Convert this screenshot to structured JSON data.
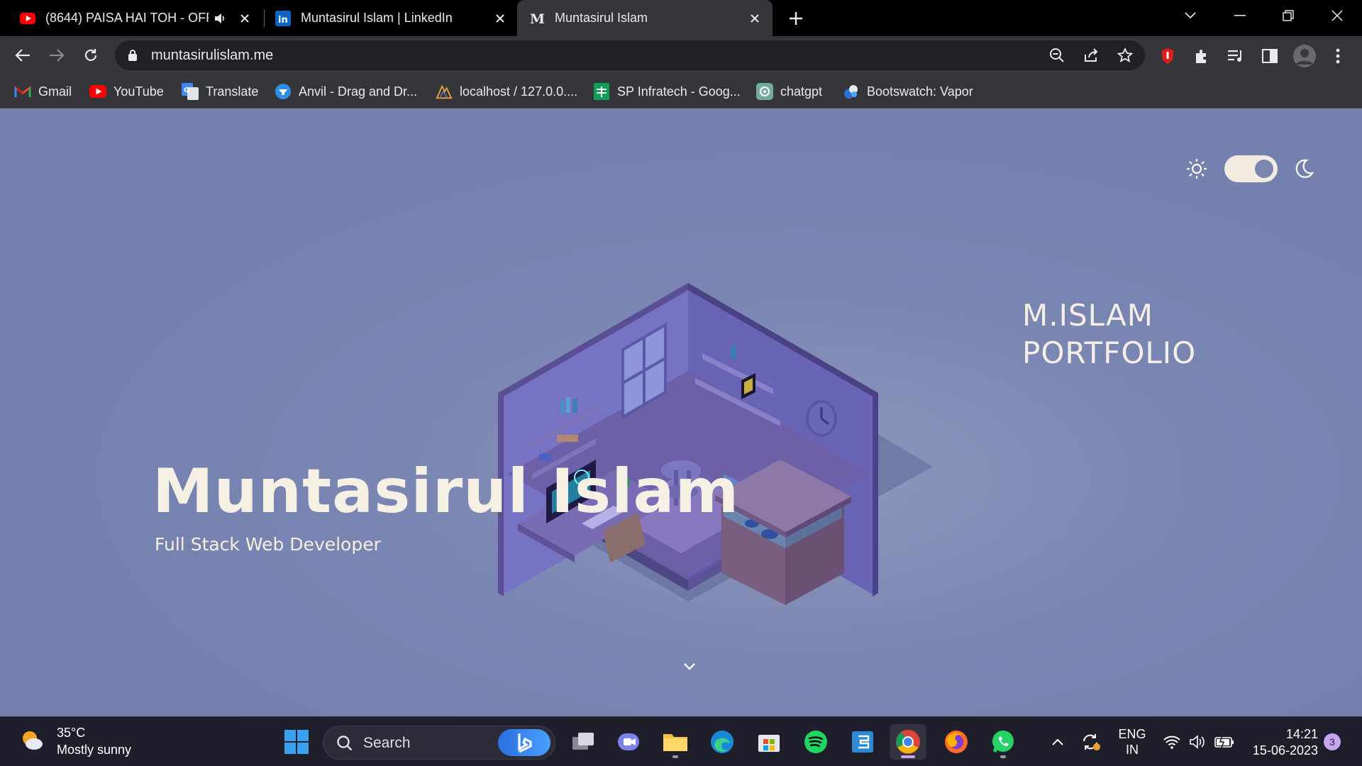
{
  "browser": {
    "tabs": [
      {
        "title": "(8644) PAISA HAI TOH - OFFI",
        "favicon": "youtube-icon",
        "audio": true
      },
      {
        "title": "Muntasirul Islam | LinkedIn",
        "favicon": "linkedin-icon"
      },
      {
        "title": "Muntasirul Islam",
        "favicon": "m-logo-icon",
        "active": true
      }
    ],
    "url": "muntasirulislam.me",
    "bookmarks": [
      {
        "label": "Gmail",
        "icon": "gmail-icon"
      },
      {
        "label": "YouTube",
        "icon": "youtube-icon"
      },
      {
        "label": "Translate",
        "icon": "translate-icon"
      },
      {
        "label": "Anvil - Drag and Dr...",
        "icon": "anvil-icon"
      },
      {
        "label": "localhost / 127.0.0....",
        "icon": "phpmyadmin-icon"
      },
      {
        "label": "SP Infratech - Goog...",
        "icon": "sheets-icon"
      },
      {
        "label": "chatgpt",
        "icon": "chatgpt-icon"
      },
      {
        "label": "Bootswatch: Vapor",
        "icon": "bootswatch-icon"
      }
    ]
  },
  "page": {
    "side_title_line1": "M.ISLAM",
    "side_title_line2": "PORTFOLIO",
    "name": "Muntasirul Islam",
    "role": "Full Stack Web Developer",
    "theme_toggle_on": true
  },
  "taskbar": {
    "weather_temp": "35°C",
    "weather_desc": "Mostly sunny",
    "search_placeholder": "Search",
    "lang_line1": "ENG",
    "lang_line2": "IN",
    "time": "14:21",
    "date": "15-06-2023",
    "notification_count": "3"
  },
  "colors": {
    "page_bg": "#7480ae",
    "hero_text": "#f6efe4",
    "toggle_track": "#f2ebe0"
  }
}
